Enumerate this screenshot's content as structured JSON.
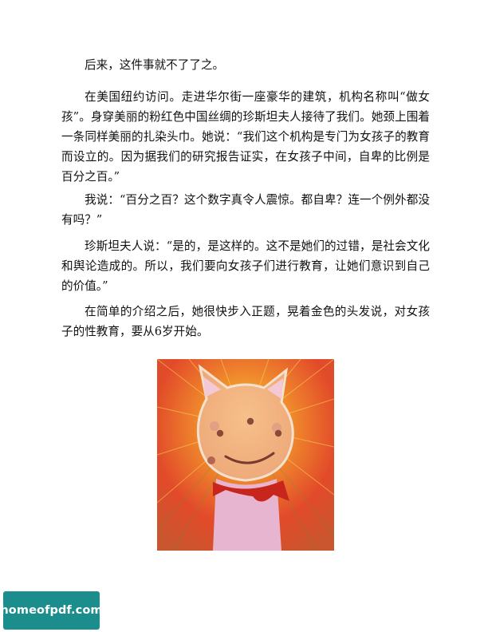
{
  "paragraphs": [
    "后来，这件事就不了了之。",
    "在美国纽约访问。走进华尔街一座豪华的建筑，机构名称叫“做女孩”。身穿美丽的粉红色中国丝绸的珍斯坦夫人接待了我们。她颈上围着一条同样美丽的扎染头巾。她说：“我们这个机构是专门为女孩子的教育而设立的。因为据我们的研究报告证实，在女孩子中间，自卑的比例是百分之百。”",
    "我说：“百分之百？这个数字真令人震惊。都自卑？连一个例外都没有吗？”",
    "珍斯坦夫人说：“是的，是这样的。这不是她们的过错，是社会文化和舆论造成的。所以，我们要向女孩子们进行教育，让她们意识到自己的价值。”",
    "在简单的介绍之后，她很快步入正题，晃着金色的头发说，对女孩子的性教育，要从6岁开始。"
  ],
  "illustration": {
    "icon": "smiling-cat-girl-illustration",
    "colors": {
      "burst": "#e9542a",
      "face": "#f2b487",
      "body": "#e8b6cf",
      "scarf": "#c8261c"
    }
  },
  "watermark": {
    "text": "homeofpdf.com",
    "color": "#1c8d8d"
  }
}
